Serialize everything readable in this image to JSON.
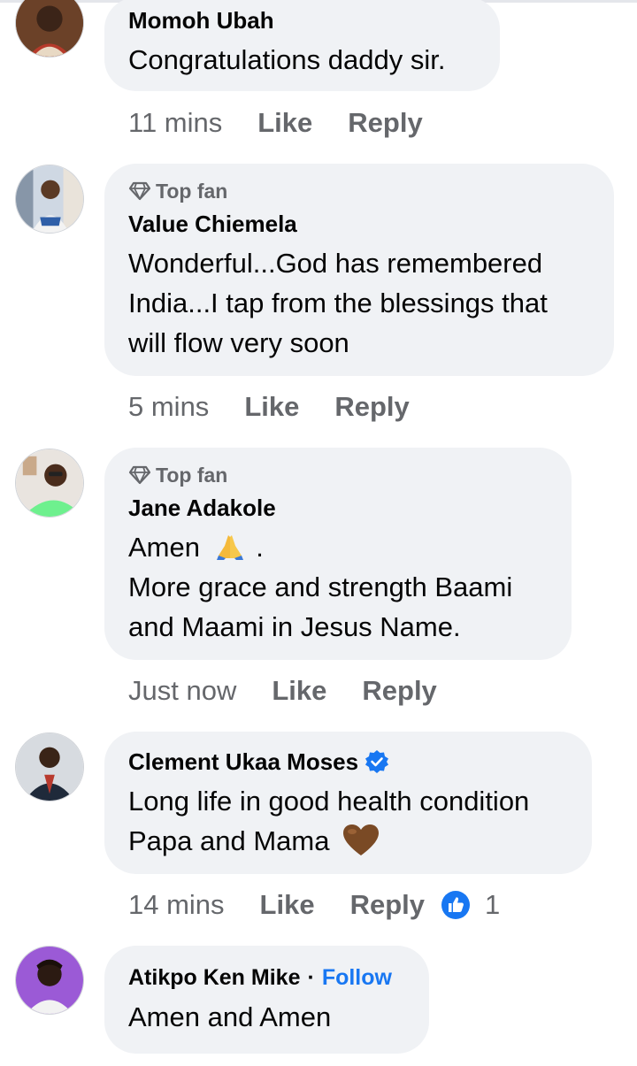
{
  "comments": [
    {
      "name": "Momoh Ubah",
      "lines": [
        "Congratulations daddy sir."
      ],
      "time": "11 mins",
      "like": "Like",
      "reply": "Reply"
    },
    {
      "badge": "Top fan",
      "name": "Value Chiemela",
      "lines": [
        "Wonderful...God has remembered",
        "India...I tap from the blessings that",
        "will flow very soon"
      ],
      "time": "5 mins",
      "like": "Like",
      "reply": "Reply"
    },
    {
      "badge": "Top fan",
      "name": "Jane Adakole",
      "line1_text": "Amen",
      "line1_suffix": ".",
      "lines": [
        "More grace and strength Baami",
        "and Maami in Jesus Name."
      ],
      "time": "Just now",
      "like": "Like",
      "reply": "Reply"
    },
    {
      "name": "Clement Ukaa Moses",
      "lines": [
        "Long life in good health condition"
      ],
      "line2_text": "Papa and Mama",
      "time": "14 mins",
      "like": "Like",
      "reply": "Reply",
      "reaction_count": "1"
    },
    {
      "name": "Atikpo Ken Mike",
      "separator": "·",
      "follow": "Follow",
      "lines": [
        "Amen and Amen"
      ]
    }
  ],
  "icons": {
    "top_fan": "diamond-icon",
    "verified": "verified-badge-icon",
    "reaction": "thumbs-up-icon",
    "praying": "praying-hands-emoji",
    "heart": "brown-heart-emoji"
  },
  "colors": {
    "bubble": "#f0f2f5",
    "meta": "#65676b",
    "link": "#1877f2"
  }
}
